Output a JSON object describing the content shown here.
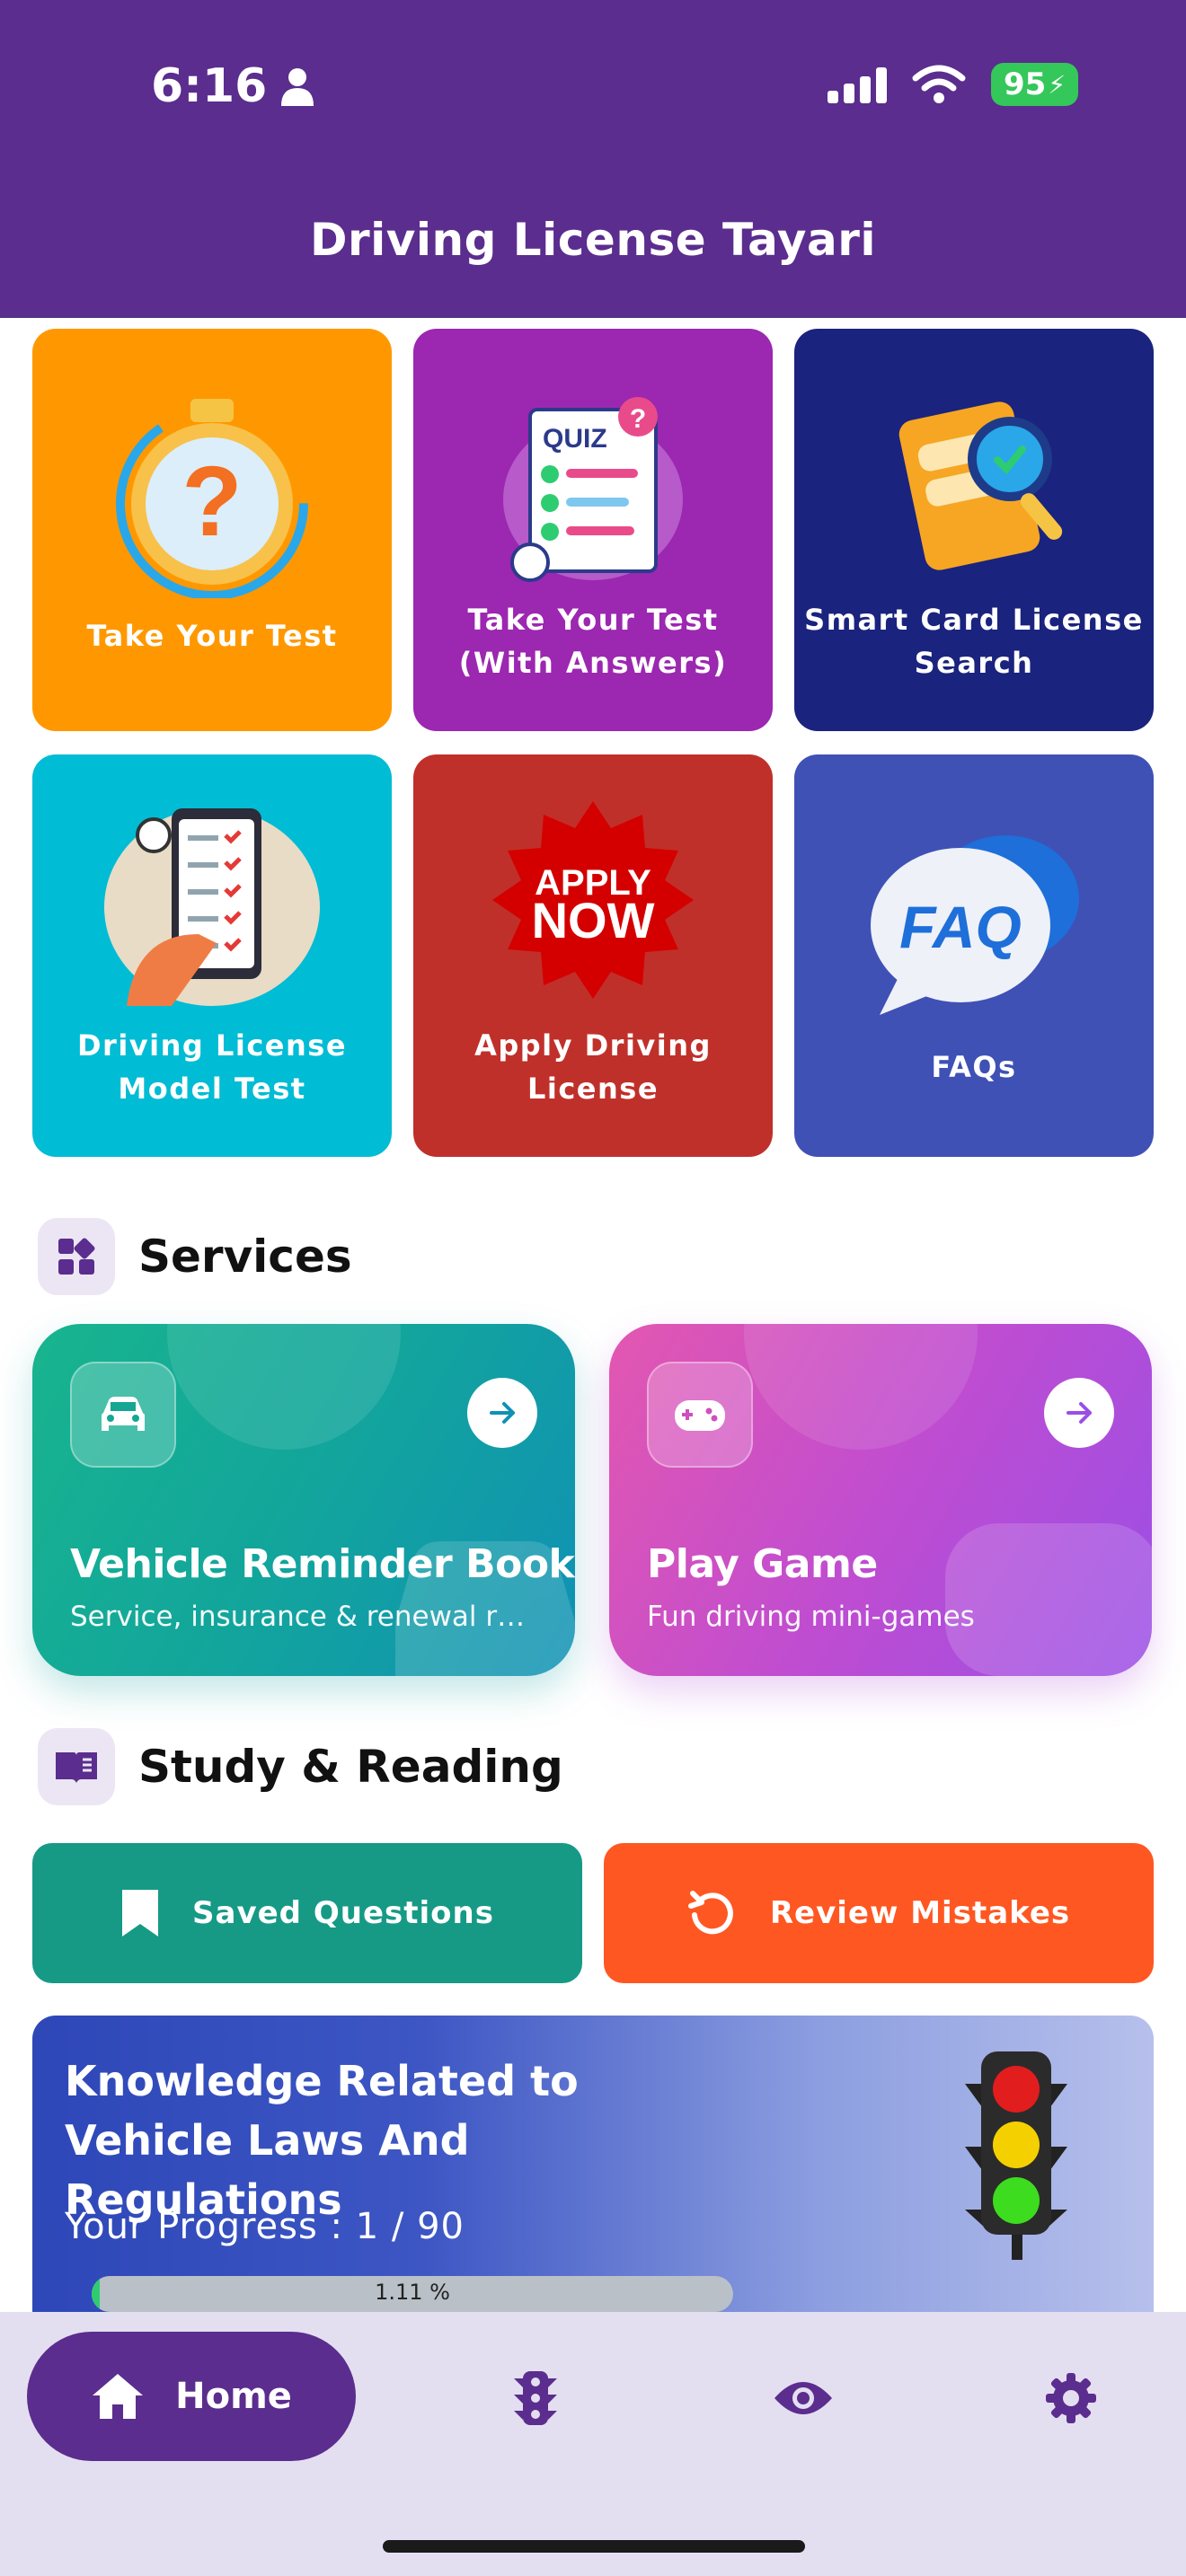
{
  "status_bar": {
    "time": "6:16",
    "battery": "95"
  },
  "header": {
    "title": "Driving License Tayari"
  },
  "tiles": [
    {
      "label": "Take Your Test",
      "color": "#ff9800"
    },
    {
      "label": "Take Your Test\n(With Answers)",
      "color": "#9c27b0"
    },
    {
      "label": "Smart Card License\nSearch",
      "color": "#1a237e"
    },
    {
      "label": "Driving License\nModel Test",
      "color": "#00bcd4"
    },
    {
      "label": "Apply Driving\nLicense",
      "color": "#c0302a"
    },
    {
      "label": "FAQs",
      "color": "#3f51b5"
    }
  ],
  "tile_art": {
    "quiz_text": "QUIZ",
    "apply_line1": "APPLY",
    "apply_line2": "NOW",
    "faq_text": "FAQ"
  },
  "services": {
    "title": "Services",
    "cards": [
      {
        "title": "Vehicle Reminder Book",
        "subtitle": "Service, insurance & renewal r…",
        "icon": "car-icon"
      },
      {
        "title": "Play Game",
        "subtitle": "Fun driving mini-games",
        "icon": "gamepad-icon"
      }
    ]
  },
  "study": {
    "title": "Study & Reading",
    "buttons": [
      {
        "label": "Saved Questions",
        "icon": "bookmark-icon",
        "color": "#169a86"
      },
      {
        "label": "Review Mistakes",
        "icon": "refresh-icon",
        "color": "#ff5722"
      }
    ]
  },
  "knowledge": {
    "title": "Knowledge Related to Vehicle Laws And Regulations",
    "progress_label": "Your Progress :  1 / 90",
    "progress_percent_text": "1.11 %",
    "progress_fraction": 0.0111
  },
  "bottom_nav": {
    "home_label": "Home",
    "items": [
      "home-icon",
      "traffic-light-icon",
      "eye-icon",
      "gear-icon"
    ],
    "accent": "#5b2d8e"
  }
}
